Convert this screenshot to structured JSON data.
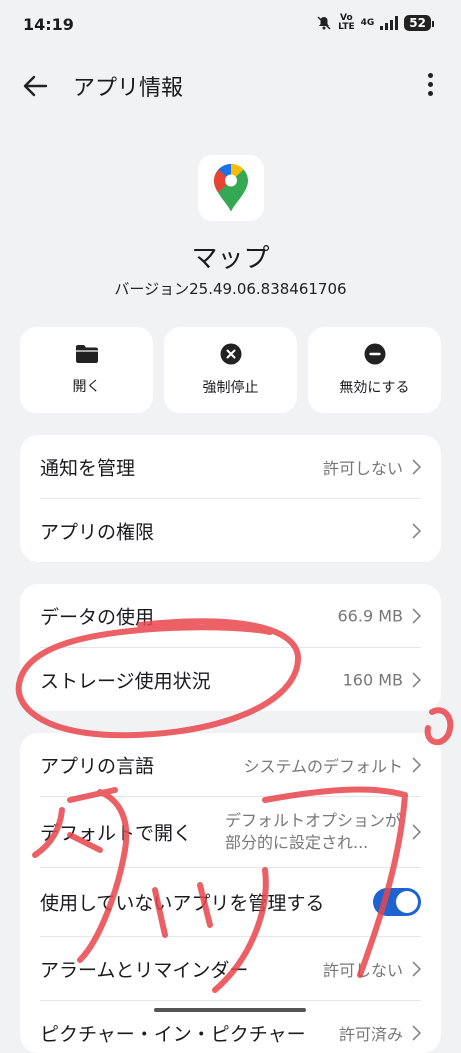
{
  "status": {
    "time": "14:19",
    "vol": "Vo",
    "lte": "LTE",
    "net": "4G",
    "battery": "52"
  },
  "appbar": {
    "title": "アプリ情報"
  },
  "app": {
    "name": "マップ",
    "version": "バージョン25.49.06.838461706"
  },
  "actions": [
    {
      "label": "開く",
      "icon": "folder-icon"
    },
    {
      "label": "強制停止",
      "icon": "close-circle-icon"
    },
    {
      "label": "無効にする",
      "icon": "minus-circle-icon"
    }
  ],
  "group1": [
    {
      "label": "通知を管理",
      "value": "許可しない"
    },
    {
      "label": "アプリの権限",
      "value": ""
    }
  ],
  "group2": [
    {
      "label": "データの使用",
      "value": "66.9 MB"
    },
    {
      "label": "ストレージ使用状況",
      "value": "160 MB"
    }
  ],
  "group3": [
    {
      "label": "アプリの言語",
      "value": "システムのデフォルト"
    },
    {
      "label": "デフォルトで開く",
      "value": "デフォルトオプションが部分的に設定され..."
    },
    {
      "label": "使用していないアプリを管理する",
      "value": "",
      "toggle": true
    },
    {
      "label": "アラームとリマインダー",
      "value": "許可しない"
    },
    {
      "label": "ピクチャー・イン・ピクチャー",
      "value": "許可済み"
    }
  ],
  "colors": {
    "accent": "#1d63d1",
    "annotation": "#e8454b"
  }
}
